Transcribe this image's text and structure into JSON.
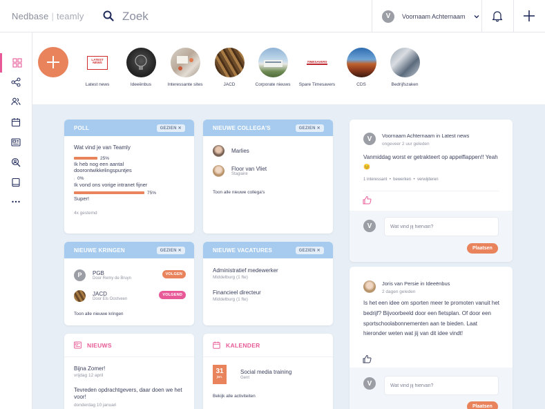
{
  "app": {
    "brand1": "Nedbase",
    "brand2": "teamly"
  },
  "search": {
    "placeholder": "Zoek"
  },
  "user": {
    "initial": "V",
    "name": "Voornaam Achternaam"
  },
  "stories": [
    {
      "label": "Latest news",
      "badge": "LATEST NEWS"
    },
    {
      "label": "Ideeënbus"
    },
    {
      "label": "Interessante sites"
    },
    {
      "label": "JACD"
    },
    {
      "label": "Corporate nieuws"
    },
    {
      "label": "Spare Timesavers",
      "badge": "TIMESAVERS"
    },
    {
      "label": "CDS"
    },
    {
      "label": "Bedrijfszaken"
    }
  ],
  "poll": {
    "title": "POLL",
    "seen": "GEZIEN",
    "question": "Wat vind je van Teamly",
    "options": [
      {
        "label": "Ik heb nog een aantal doorontwikkelingspuntjes",
        "percent": 25,
        "pct_label": "25%"
      },
      {
        "label": "Ik vond ons vorige intranet fijner",
        "percent": 0,
        "pct_label": "0%"
      },
      {
        "label": "Super!",
        "percent": 75,
        "pct_label": "75%"
      }
    ],
    "votes": "4x gestemd"
  },
  "colleagues": {
    "title": "NIEUWE COLLEGA'S",
    "seen": "GEZIEN",
    "people": [
      {
        "name": "Marlies",
        "role": ""
      },
      {
        "name": "Floor van Vliet",
        "role": "Stagiaire"
      }
    ],
    "all_link": "Toon alle nieuwe collega's"
  },
  "circles": {
    "title": "NIEUWE KRINGEN",
    "seen": "GEZIEN",
    "items": [
      {
        "initial": "P",
        "name": "PGB",
        "by": "Door Remy de Bruyn",
        "action": "VOLGEN"
      },
      {
        "name": "JACD",
        "by": "Door Els Oostveen",
        "action": "VOLGEND"
      }
    ],
    "all_link": "Toon alle nieuwe kringen"
  },
  "vacancies": {
    "title": "NIEUWE VACATURES",
    "seen": "GEZIEN",
    "items": [
      {
        "title": "Administratief medewerker",
        "place": "Middelburg (1 fte)"
      },
      {
        "title": "Financieel directeur",
        "place": "Middelburg (1 fte)"
      }
    ]
  },
  "news": {
    "title": "NIEUWS",
    "items": [
      {
        "title": "Bijna Zomer!",
        "date": "vrijdag 12 april"
      },
      {
        "title": "Tevreden opdrachtgevers, daar doen we het voor!",
        "date": "donderdag 10 januari"
      }
    ]
  },
  "calendar": {
    "title": "KALENDER",
    "day": "31",
    "month": "jan.",
    "event": "Social media training",
    "place": "Gent",
    "all_link": "Bekijk alle activiteiten"
  },
  "feed": [
    {
      "initial": "V",
      "author": "Voornaam Achternaam",
      "in": "in",
      "channel": "Latest news",
      "time": "ongeveer 2 uur geleden",
      "text": "Vanmiddag worst er getrakteert op appelflappen!! Yeah 😊",
      "stats": "1 interessant",
      "edit": "bewerken",
      "delete": "verwijderen",
      "comment_placeholder": "Wat vind jij hiervan?",
      "post": "Plaatsen"
    },
    {
      "author": "Joris van Persie",
      "in": "in",
      "channel": "Ideeënbus",
      "time": "2 dagen geleden",
      "text": "Is het een idee om sporten meer te promoten vanuit het bedrijf? Bijvoorbeeld door een fietsplan. Of door een sportschoolabonnementen aan te bieden. Laat hieronder weten wat jij van dit idee vindt!",
      "comment_placeholder": "Wat vind jij hiervan?",
      "post": "Plaatsen"
    }
  ],
  "comment_initial": "V",
  "colors": {
    "accent": "#e8835c",
    "pink": "#e85a97",
    "header_blue": "#a6cbee",
    "bg": "#e7eef6"
  }
}
